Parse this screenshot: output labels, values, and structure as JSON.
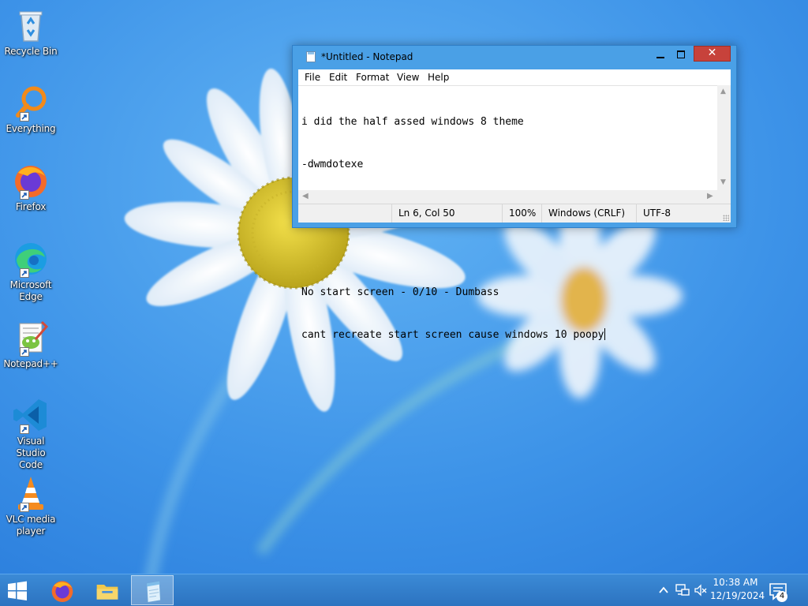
{
  "desktop": {
    "icons": [
      {
        "label": "Recycle Bin",
        "icon": "recycle-bin-icon",
        "shortcut": false
      },
      {
        "label": "Everything",
        "icon": "everything-search-icon",
        "shortcut": true
      },
      {
        "label": "Firefox",
        "icon": "firefox-icon",
        "shortcut": true
      },
      {
        "label": "Microsoft Edge",
        "icon": "edge-icon",
        "shortcut": true
      },
      {
        "label": "Notepad++",
        "icon": "notepad-plus-plus-icon",
        "shortcut": true
      },
      {
        "label": "Visual Studio Code",
        "icon": "vscode-icon",
        "shortcut": true
      },
      {
        "label": "VLC media player",
        "icon": "vlc-icon",
        "shortcut": true
      }
    ]
  },
  "notepad": {
    "title": "*Untitled - Notepad",
    "menu": [
      "File",
      "Edit",
      "Format",
      "View",
      "Help"
    ],
    "lines": [
      "i did the half assed windows 8 theme",
      "-dwmdotexe",
      "",
      "",
      "No start screen - 0/10 - Dumbass",
      "cant recreate start screen cause windows 10 poopy"
    ],
    "status": {
      "position": "Ln 6, Col 50",
      "zoom": "100%",
      "line_endings": "Windows (CRLF)",
      "encoding": "UTF-8"
    },
    "close_symbol": "✕"
  },
  "taskbar": {
    "pinned": [
      {
        "name": "firefox",
        "icon": "firefox-icon"
      },
      {
        "name": "file-explorer",
        "icon": "folder-icon"
      },
      {
        "name": "notepad",
        "icon": "notepad-icon",
        "active": true
      }
    ],
    "tray": {
      "overflow": "show-hidden-icons-icon",
      "network": "network-icon",
      "volume": "volume-muted-icon"
    },
    "clock": {
      "time": "10:38 AM",
      "date": "12/19/2024"
    },
    "notifications": {
      "count": "4"
    }
  },
  "colors": {
    "wallpaper_sky": "#3a8ee6",
    "window_frame": "#4aa0e6",
    "close_button": "#c7423b",
    "taskbar": "#2c73c0"
  }
}
